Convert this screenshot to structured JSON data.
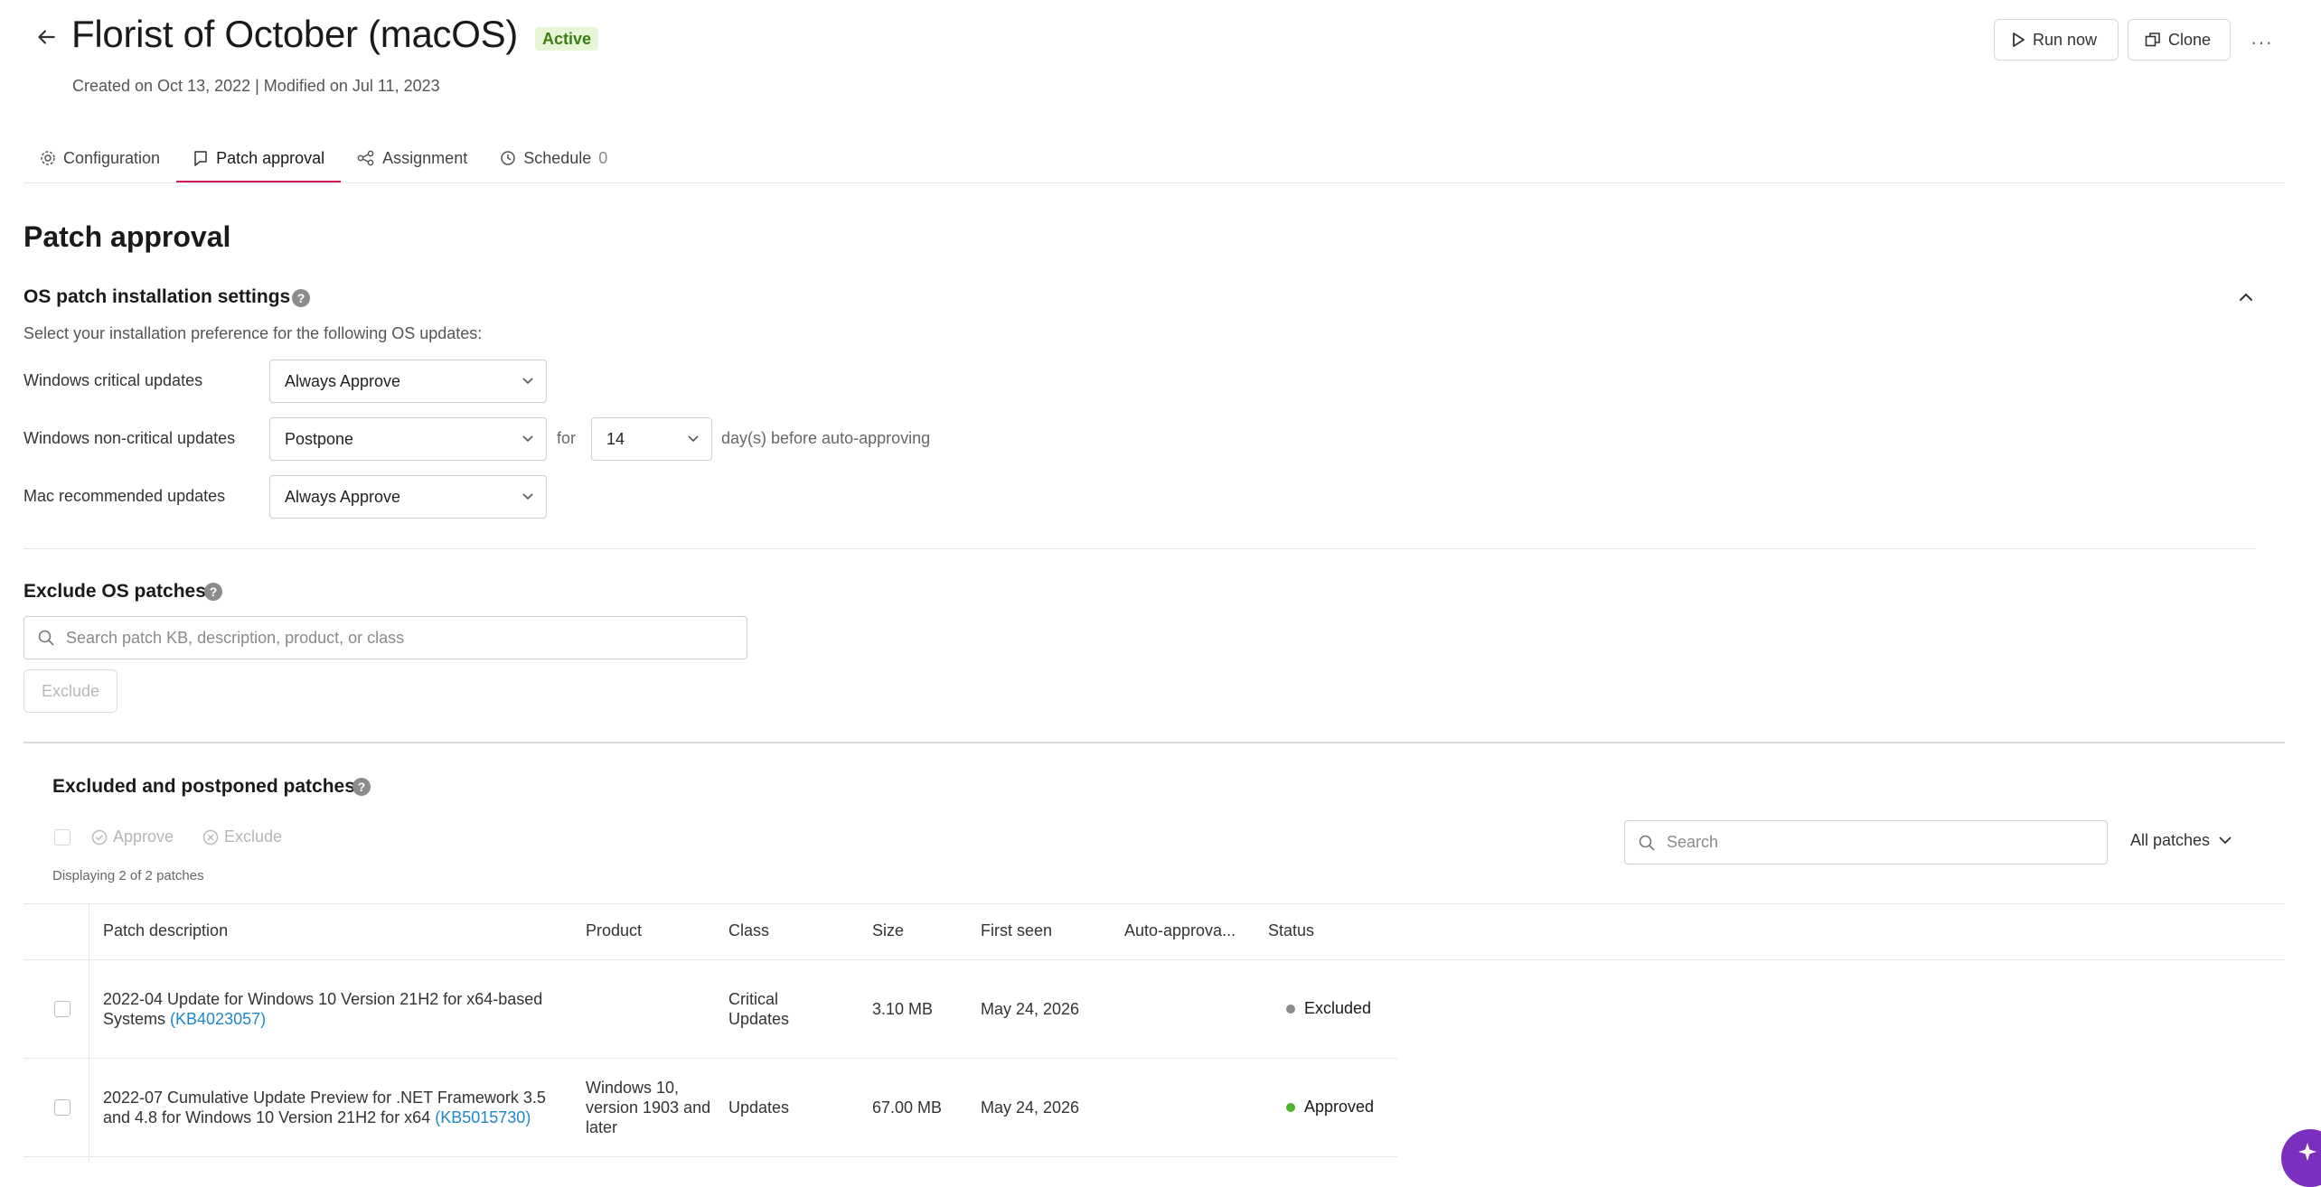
{
  "header": {
    "title": "Florist of October (macOS)",
    "badge": "Active",
    "subtitle": "Created on Oct 13, 2022 | Modified on Jul 11, 2023",
    "run_now": "Run now",
    "clone": "Clone",
    "more": "···"
  },
  "tabs": [
    {
      "label": "Configuration",
      "icon": "gear-icon"
    },
    {
      "label": "Patch approval",
      "icon": "approval-icon",
      "active": true
    },
    {
      "label": "Assignment",
      "icon": "share-icon"
    },
    {
      "label": "Schedule",
      "count": "0",
      "icon": "clock-icon"
    }
  ],
  "page_title": "Patch approval",
  "os_settings": {
    "title": "OS patch installation settings",
    "description": "Select your installation preference for the following OS updates:",
    "rows": [
      {
        "label": "Windows critical updates",
        "value": "Always Approve"
      },
      {
        "label": "Windows non-critical updates",
        "value": "Postpone",
        "for_label": "for",
        "days": "14",
        "suffix": "day(s) before auto-approving"
      },
      {
        "label": "Mac recommended updates",
        "value": "Always Approve"
      }
    ]
  },
  "exclude": {
    "title": "Exclude OS patches",
    "placeholder": "Search patch KB, description, product, or class",
    "button": "Exclude"
  },
  "excluded_section": {
    "title": "Excluded and postponed patches",
    "approve": "Approve",
    "exclude": "Exclude",
    "displaying": "Displaying 2 of 2 patches",
    "search_placeholder": "Search",
    "filter": "All patches"
  },
  "table": {
    "columns": [
      "Patch description",
      "Product",
      "Class",
      "Size",
      "First seen",
      "Auto-approva...",
      "Status"
    ],
    "rows": [
      {
        "description": "2022-04 Update for Windows 10 Version 21H2 for x64-based Systems",
        "kb": "(KB4023057)",
        "product": "",
        "class": "Critical Updates",
        "size": "3.10 MB",
        "first_seen": "May 24, 2026",
        "auto": "",
        "status": "Excluded",
        "status_color": "#8c8c8c"
      },
      {
        "description": "2022-07 Cumulative Update Preview for .NET Framework 3.5 and 4.8 for Windows 10 Version 21H2 for x64",
        "kb": "(KB5015730)",
        "product": "Windows 10, version 1903 and later",
        "class": "Updates",
        "size": "67.00 MB",
        "first_seen": "May 24, 2026",
        "auto": "",
        "status": "Approved",
        "status_color": "#52b330"
      }
    ]
  },
  "colors": {
    "accent": "#d0165a",
    "link": "#1e88c7",
    "badge_bg": "#e6f6d7",
    "badge_text": "#3c7d12",
    "fab": "#7b2fbf"
  }
}
